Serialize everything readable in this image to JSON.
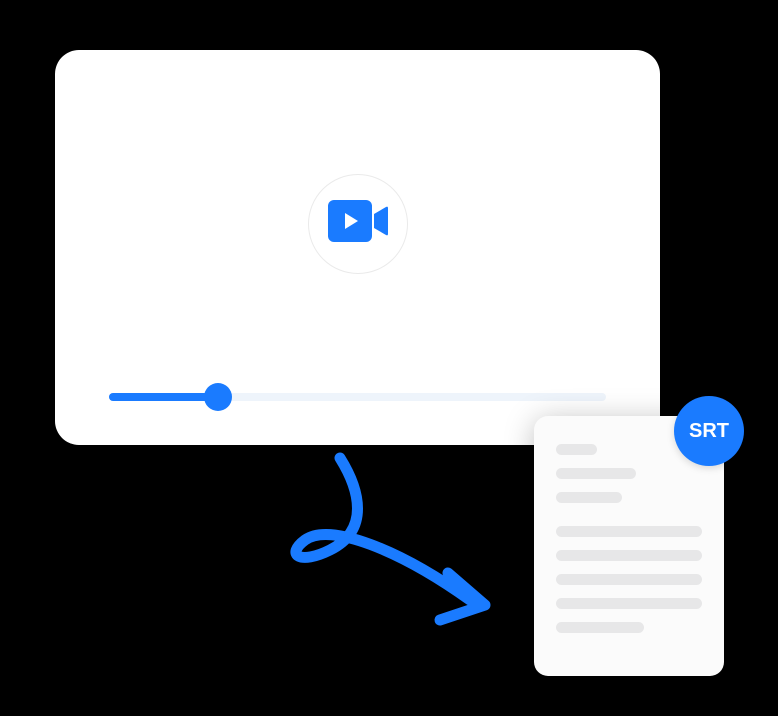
{
  "diagram": {
    "video_icon": "video-camera-play",
    "slider_progress_percent": 22,
    "badge_label": "SRT",
    "arrow_direction": "down-right"
  }
}
